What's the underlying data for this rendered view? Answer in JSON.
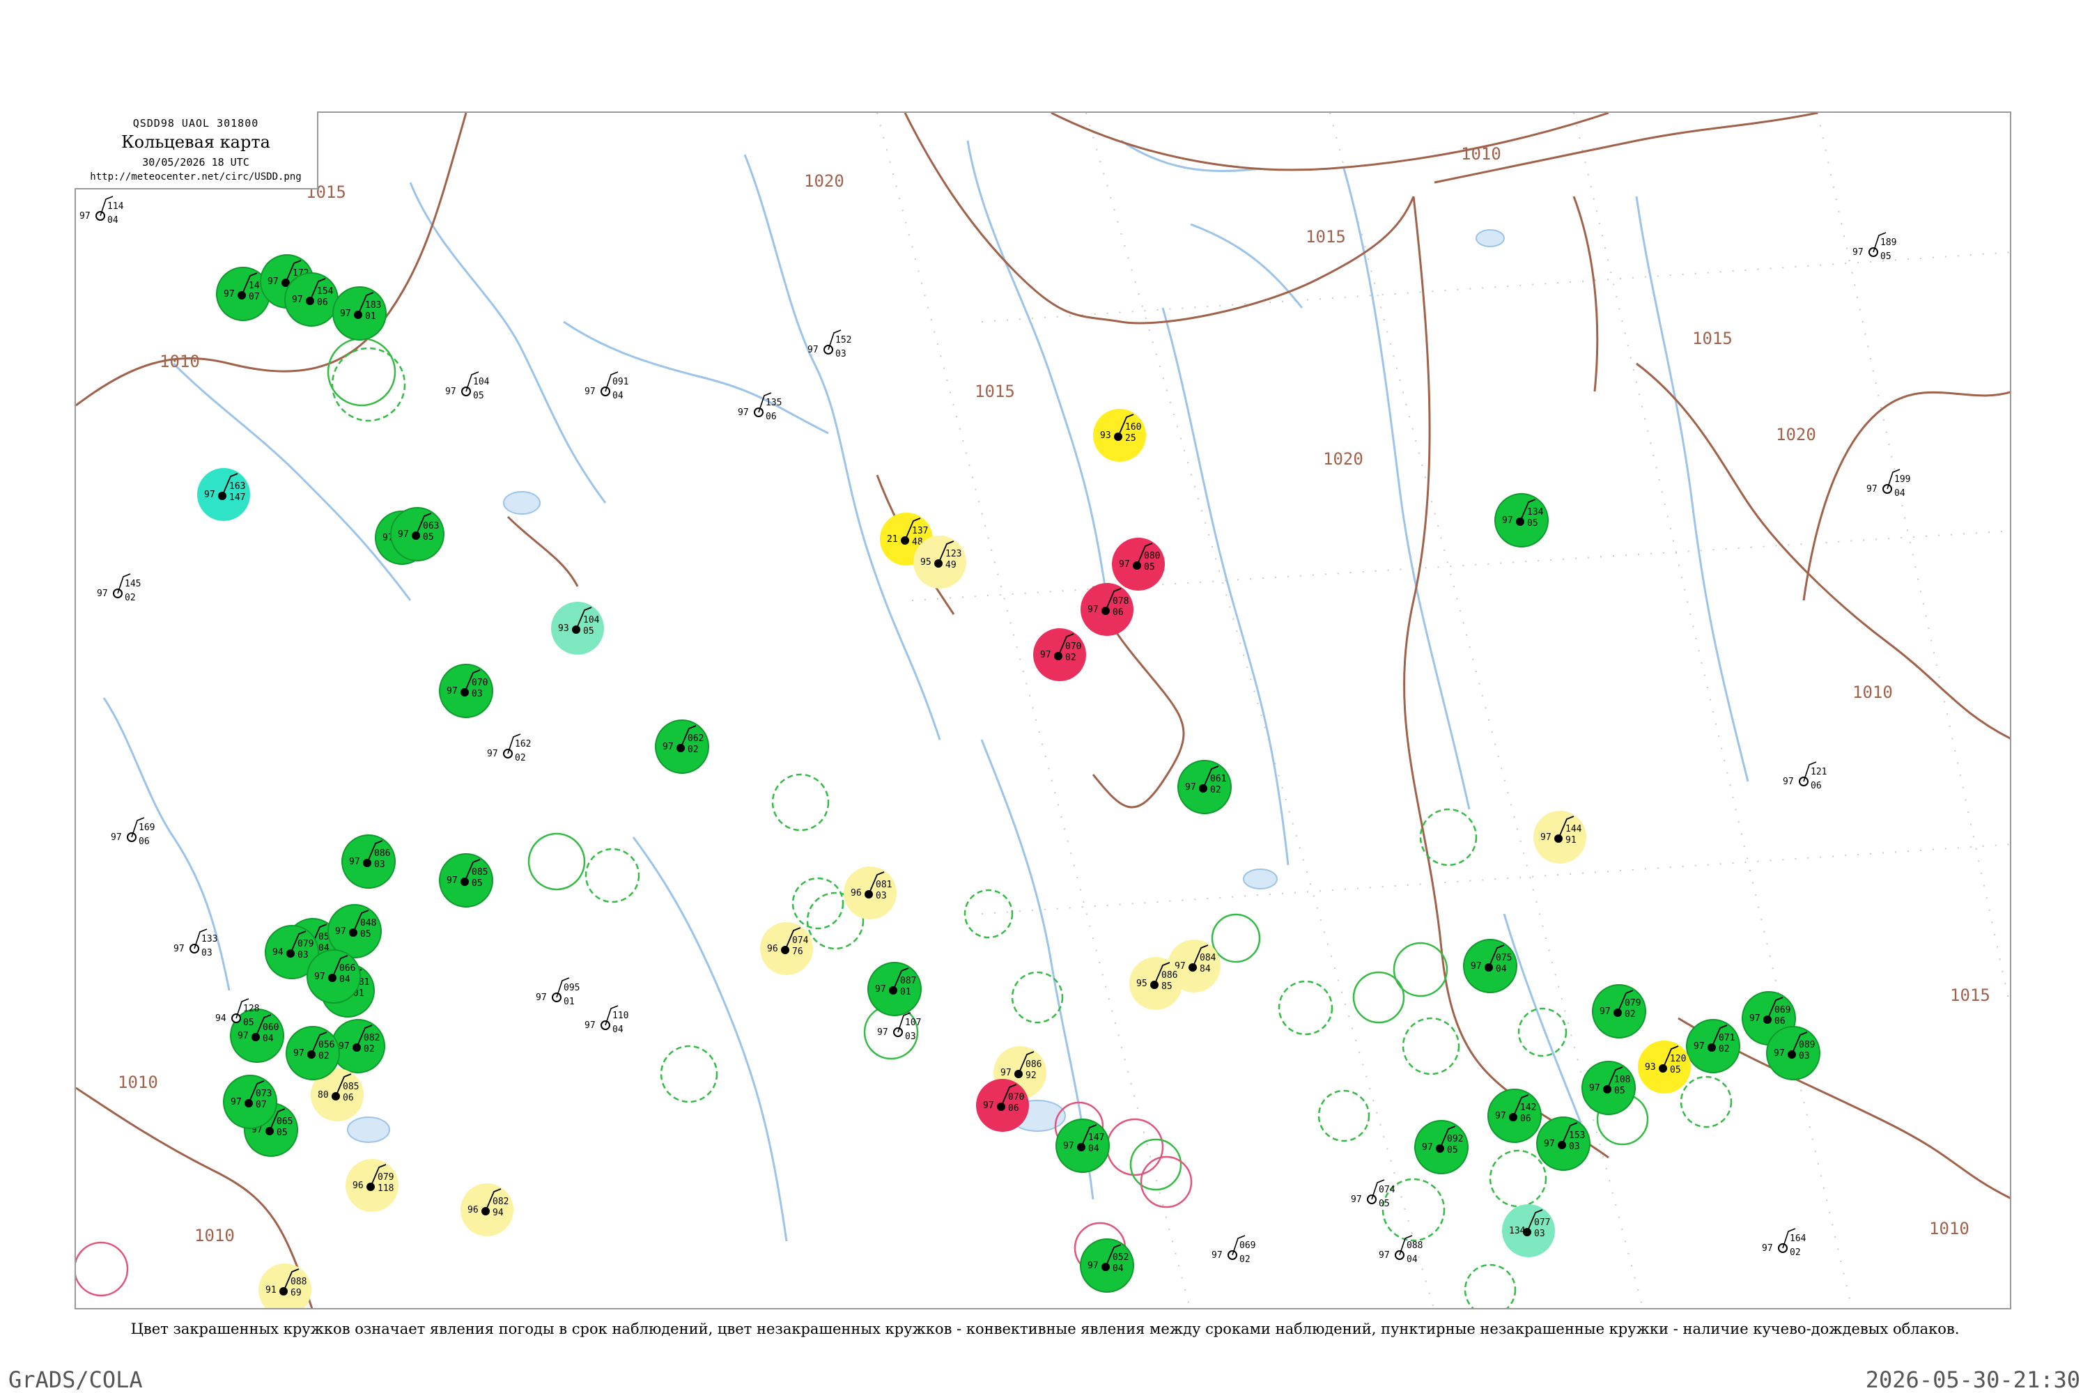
{
  "header": {
    "bulletin_code": "QSDD98  UAOL  301800",
    "title": "Кольцевая карта",
    "datetime": "30/05/2026 18 UTC",
    "url": "http://meteocenter.net/circ/USDD.png"
  },
  "legend_note": "Цвет закрашенных кружков означает явления погоды в срок наблюдений, цвет незакрашенных кружков - конвективные явления между сроками наблюдений, пунктирные незакрашенные кружки - наличие кучево-дождевых облаков.",
  "footer": {
    "left": "GrADS/COLA",
    "right": "2026-05-30-21:30"
  },
  "colors": {
    "green_fill": "#12c43a",
    "yellow_fill": "#ffee22",
    "light_yellow_fill": "#fbf3a2",
    "red_fill": "#ea2f5c",
    "cyan_fill": "#2ee3c6",
    "light_cyan_fill": "#7de8c0",
    "green_ring": "#33bb44",
    "red_ring": "#e0557a",
    "isobar": "#a0624a",
    "river": "#9cc4ea",
    "border": "#9a9a9a"
  },
  "isobar_labels": [
    "1010",
    "1015",
    "1020",
    "1015",
    "1010",
    "1015",
    "1020",
    "1015",
    "1020",
    "1015",
    "1010",
    "1010",
    "1010",
    "1010"
  ],
  "stations": [
    {
      "kind": "filled",
      "fill": "green",
      "p": "147",
      "t": "97",
      "d": "07"
    },
    {
      "kind": "filled",
      "fill": "green",
      "p": "172",
      "t": "97",
      "d": "02"
    },
    {
      "kind": "filled",
      "fill": "green",
      "p": "154",
      "t": "97",
      "d": "06"
    },
    {
      "kind": "filled",
      "fill": "green",
      "p": "183",
      "t": "97",
      "d": "01"
    },
    {
      "kind": "filled",
      "fill": "cyan",
      "p": "163",
      "t": "97",
      "d": "147"
    },
    {
      "kind": "filled",
      "fill": "green",
      "p": "142",
      "t": "97",
      "d": "05"
    },
    {
      "kind": "filled",
      "fill": "yellow",
      "p": "160",
      "t": "93",
      "d": "25"
    },
    {
      "kind": "filled",
      "fill": "yellow",
      "p": "137",
      "t": "21",
      "d": "48"
    },
    {
      "kind": "filled",
      "fill": "light_yellow",
      "p": "123",
      "t": "95",
      "d": "49"
    },
    {
      "kind": "filled",
      "fill": "red",
      "p": "080",
      "t": "97",
      "d": "05"
    },
    {
      "kind": "filled",
      "fill": "red",
      "p": "078",
      "t": "97",
      "d": "06"
    },
    {
      "kind": "filled",
      "fill": "red",
      "p": "070",
      "t": "97",
      "d": "02"
    },
    {
      "kind": "filled",
      "fill": "light_cyan",
      "p": "104",
      "t": "93",
      "d": "05"
    },
    {
      "kind": "filled",
      "fill": "green",
      "p": "086",
      "t": "97",
      "d": "03"
    },
    {
      "kind": "filled",
      "fill": "green",
      "p": "061",
      "t": "97",
      "d": "02"
    },
    {
      "kind": "filled",
      "fill": "green",
      "p": "059",
      "t": "97",
      "d": "04"
    },
    {
      "kind": "filled",
      "fill": "green",
      "p": "048",
      "t": "97",
      "d": "05"
    },
    {
      "kind": "filled",
      "fill": "green",
      "p": "081",
      "t": "97",
      "d": "01"
    },
    {
      "kind": "filled",
      "fill": "green",
      "p": "079",
      "t": "94",
      "d": "03"
    },
    {
      "kind": "filled",
      "fill": "green",
      "p": "066",
      "t": "97",
      "d": "04"
    },
    {
      "kind": "filled",
      "fill": "green",
      "p": "082",
      "t": "97",
      "d": "02"
    },
    {
      "kind": "filled",
      "fill": "green",
      "p": "065",
      "t": "97",
      "d": "05"
    },
    {
      "kind": "filled",
      "fill": "light_yellow",
      "p": "085",
      "t": "80",
      "d": "06"
    },
    {
      "kind": "filled",
      "fill": "green",
      "p": "060",
      "t": "97",
      "d": "04"
    },
    {
      "kind": "filled",
      "fill": "green",
      "p": "056",
      "t": "97",
      "d": "02"
    },
    {
      "kind": "filled",
      "fill": "green",
      "p": "073",
      "t": "97",
      "d": "07"
    },
    {
      "kind": "filled",
      "fill": "green",
      "p": "062",
      "t": "97",
      "d": "02"
    },
    {
      "kind": "filled",
      "fill": "green",
      "p": "085",
      "t": "97",
      "d": "05"
    },
    {
      "kind": "filled",
      "fill": "light_yellow",
      "p": "081",
      "t": "96",
      "d": "03"
    },
    {
      "kind": "filled",
      "fill": "light_yellow",
      "p": "084",
      "t": "97",
      "d": "84"
    },
    {
      "kind": "filled",
      "fill": "light_yellow",
      "p": "086",
      "t": "95",
      "d": "85"
    },
    {
      "kind": "filled",
      "fill": "light_yellow",
      "p": "086",
      "t": "97",
      "d": "92"
    },
    {
      "kind": "filled",
      "fill": "light_yellow",
      "p": "082",
      "t": "96",
      "d": "94"
    },
    {
      "kind": "filled",
      "fill": "light_yellow",
      "p": "088",
      "t": "91",
      "d": "69"
    },
    {
      "kind": "filled",
      "fill": "light_yellow",
      "p": "079",
      "t": "96",
      "d": "118"
    },
    {
      "kind": "filled",
      "fill": "light_yellow",
      "p": "074",
      "t": "96",
      "d": "76"
    },
    {
      "kind": "filled",
      "fill": "red",
      "p": "070",
      "t": "97",
      "d": "06"
    },
    {
      "kind": "filled",
      "fill": "green",
      "p": "052",
      "t": "97",
      "d": "04"
    },
    {
      "kind": "filled",
      "fill": "green",
      "p": "070",
      "t": "97",
      "d": "03"
    },
    {
      "kind": "filled",
      "fill": "green",
      "p": "063",
      "t": "97",
      "d": "05"
    },
    {
      "kind": "filled",
      "fill": "green",
      "p": "087",
      "t": "97",
      "d": "01"
    },
    {
      "kind": "filled",
      "fill": "green",
      "p": "075",
      "t": "97",
      "d": "04"
    },
    {
      "kind": "filled",
      "fill": "green",
      "p": "142",
      "t": "97",
      "d": "06"
    },
    {
      "kind": "filled",
      "fill": "green",
      "p": "092",
      "t": "97",
      "d": "05"
    },
    {
      "kind": "filled",
      "fill": "light_cyan",
      "p": "077",
      "t": "134",
      "d": "03"
    },
    {
      "kind": "filled",
      "fill": "green",
      "p": "079",
      "t": "97",
      "d": "02"
    },
    {
      "kind": "filled",
      "fill": "green",
      "p": "147",
      "t": "97",
      "d": "04"
    },
    {
      "kind": "filled",
      "fill": "green",
      "p": "153",
      "t": "97",
      "d": "03"
    },
    {
      "kind": "filled",
      "fill": "green",
      "p": "108",
      "t": "97",
      "d": "05"
    },
    {
      "kind": "filled",
      "fill": "green",
      "p": "071",
      "t": "97",
      "d": "02"
    },
    {
      "kind": "filled",
      "fill": "green",
      "p": "069",
      "t": "97",
      "d": "06"
    },
    {
      "kind": "filled",
      "fill": "green",
      "p": "089",
      "t": "97",
      "d": "03"
    },
    {
      "kind": "filled",
      "fill": "yellow",
      "p": "120",
      "t": "93",
      "d": "05"
    },
    {
      "kind": "filled",
      "fill": "light_yellow",
      "p": "144",
      "t": "97",
      "d": "91"
    },
    {
      "kind": "filled",
      "fill": "green",
      "p": "134",
      "t": "97",
      "d": "05"
    }
  ],
  "plain_stations": [
    {
      "p": "114",
      "t": "97",
      "d": "04"
    },
    {
      "p": "145",
      "t": "97",
      "d": "02"
    },
    {
      "p": "169",
      "t": "97",
      "d": "06"
    },
    {
      "p": "133",
      "t": "97",
      "d": "03"
    },
    {
      "p": "128",
      "t": "94",
      "d": "05"
    },
    {
      "p": "095",
      "t": "97",
      "d": "01"
    },
    {
      "p": "110",
      "t": "97",
      "d": "04"
    },
    {
      "p": "162",
      "t": "97",
      "d": "02"
    },
    {
      "p": "104",
      "t": "97",
      "d": "05"
    },
    {
      "p": "091",
      "t": "97",
      "d": "04"
    },
    {
      "p": "135",
      "t": "97",
      "d": "06"
    },
    {
      "p": "152",
      "t": "97",
      "d": "03"
    },
    {
      "p": "189",
      "t": "97",
      "d": "05"
    },
    {
      "p": "199",
      "t": "97",
      "d": "04"
    },
    {
      "p": "164",
      "t": "97",
      "d": "02"
    },
    {
      "p": "121",
      "t": "97",
      "d": "06"
    },
    {
      "p": "107",
      "t": "97",
      "d": "03"
    },
    {
      "p": "088",
      "t": "97",
      "d": "04"
    },
    {
      "p": "074",
      "t": "97",
      "d": "05"
    },
    {
      "p": "069",
      "t": "97",
      "d": "02"
    }
  ],
  "rings": [
    {
      "color": "green",
      "style": "solid"
    },
    {
      "color": "green",
      "style": "dashed"
    },
    {
      "color": "red",
      "style": "solid"
    },
    {
      "color": "green",
      "style": "dashed"
    },
    {
      "color": "green",
      "style": "solid"
    },
    {
      "color": "green",
      "style": "dashed"
    },
    {
      "color": "red",
      "style": "solid"
    },
    {
      "color": "green",
      "style": "dashed"
    },
    {
      "color": "green",
      "style": "solid"
    },
    {
      "color": "green",
      "style": "dashed"
    },
    {
      "color": "green",
      "style": "dashed"
    },
    {
      "color": "green",
      "style": "solid"
    },
    {
      "color": "red",
      "style": "solid"
    },
    {
      "color": "green",
      "style": "dashed"
    },
    {
      "color": "green",
      "style": "dashed"
    },
    {
      "color": "green",
      "style": "solid"
    },
    {
      "color": "green",
      "style": "dashed"
    },
    {
      "color": "green",
      "style": "dashed"
    },
    {
      "color": "red",
      "style": "solid"
    },
    {
      "color": "green",
      "style": "dashed"
    },
    {
      "color": "green",
      "style": "solid"
    },
    {
      "color": "green",
      "style": "dashed"
    },
    {
      "color": "green",
      "style": "dashed"
    },
    {
      "color": "green",
      "style": "solid"
    },
    {
      "color": "green",
      "style": "dashed"
    },
    {
      "color": "green",
      "style": "dashed"
    },
    {
      "color": "red",
      "style": "solid"
    },
    {
      "color": "green",
      "style": "dashed"
    },
    {
      "color": "green",
      "style": "solid"
    },
    {
      "color": "green",
      "style": "dashed"
    }
  ]
}
